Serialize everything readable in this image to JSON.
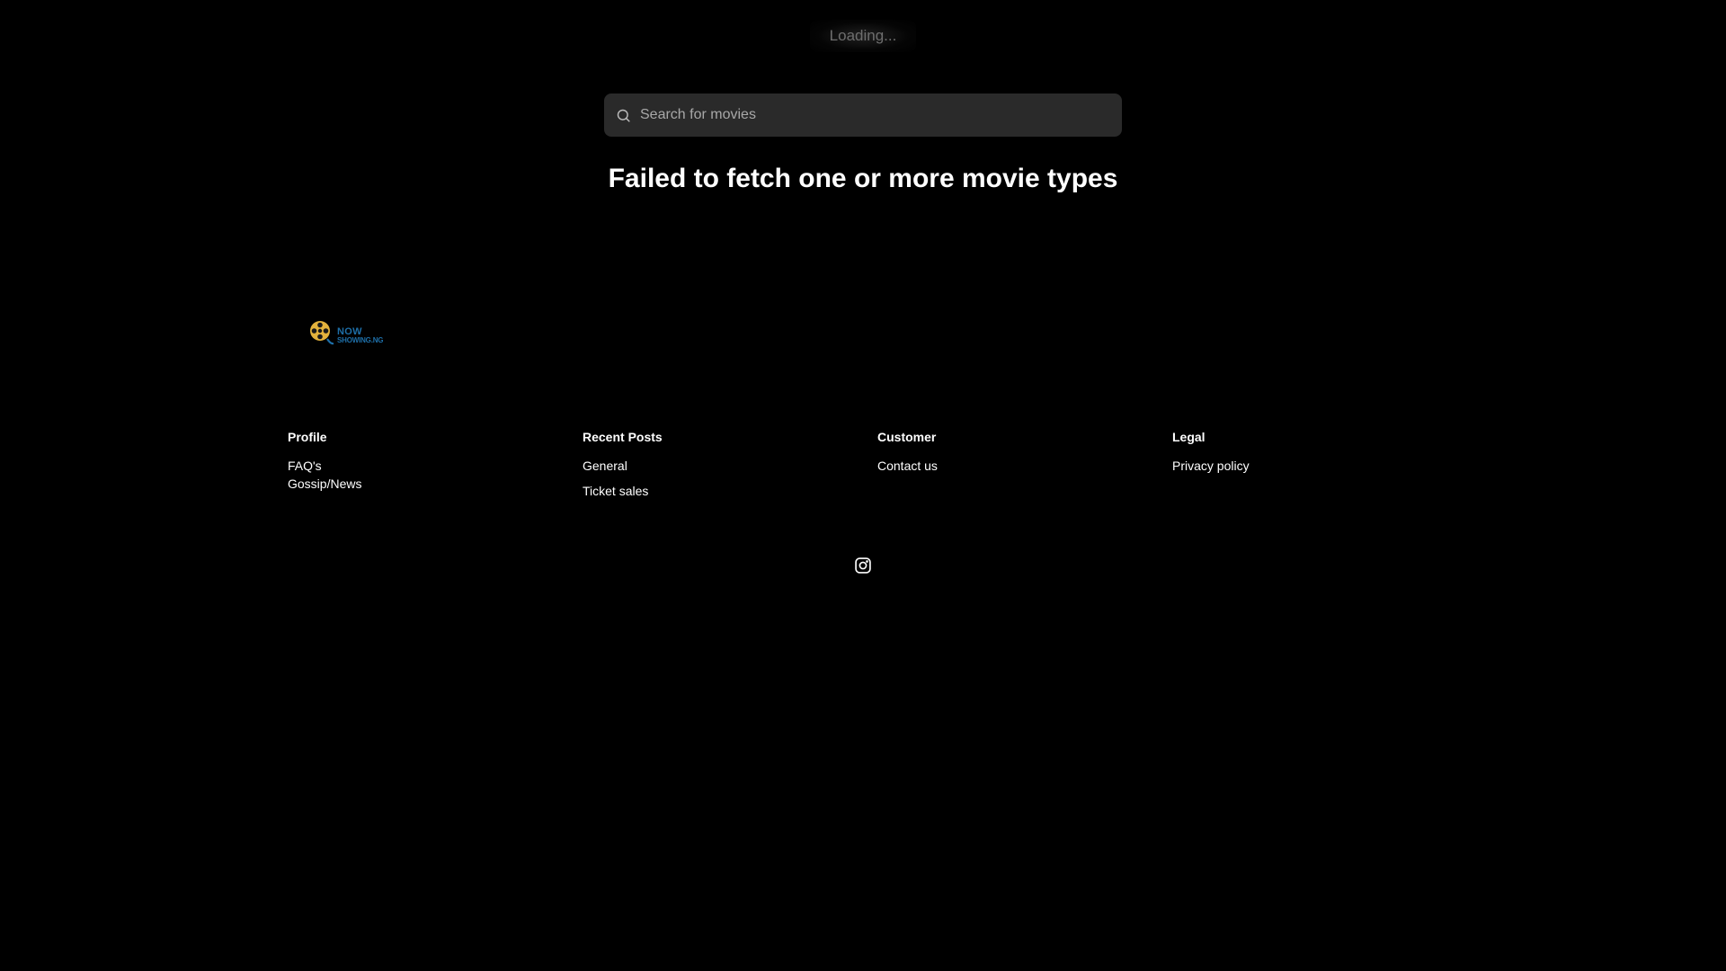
{
  "status": {
    "loading_text": "Loading..."
  },
  "search": {
    "placeholder": "Search for movies",
    "value": "",
    "icon": "search-icon"
  },
  "error": {
    "message": "Failed to fetch one or more movie types"
  },
  "logo": {
    "line1": "NOW",
    "line2": "SHOWING.NG",
    "colors": {
      "reel": "#e3b23c",
      "text": "#1e6fa8"
    }
  },
  "footer": {
    "columns": [
      {
        "heading": "Profile",
        "links": [
          "FAQ's",
          "Gossip/News"
        ]
      },
      {
        "heading": "Recent Posts",
        "links": [
          "General",
          "Ticket sales"
        ]
      },
      {
        "heading": "Customer",
        "links": [
          "Contact us"
        ]
      },
      {
        "heading": "Legal",
        "links": [
          "Privacy policy"
        ]
      }
    ],
    "social": {
      "icon": "instagram-icon"
    }
  },
  "colors": {
    "background": "#000000",
    "search_bg": "#2a2a2a",
    "text": "#ffffff",
    "placeholder": "#a8a8a8",
    "muted": "#6e6e6e"
  }
}
